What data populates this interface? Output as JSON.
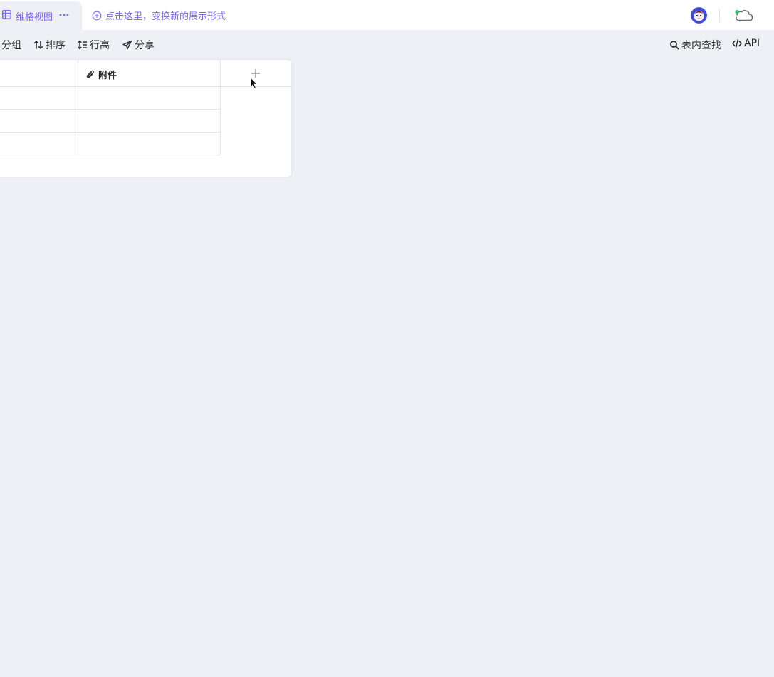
{
  "tabs": {
    "active_view": {
      "label": "维格视图",
      "icon": "grid-view-icon"
    },
    "add_view_label": "点击这里，变换新的展示形式"
  },
  "toolbar": {
    "group_label": "分组",
    "sort_label": "排序",
    "row_height_label": "行高",
    "share_label": "分享",
    "search_label": "表内查找",
    "api_label": "API"
  },
  "grid": {
    "columns": [
      {
        "name": "",
        "type": "text"
      },
      {
        "name": "附件",
        "type": "attachment",
        "icon": "attachment-icon"
      }
    ],
    "rows": [
      [
        "",
        ""
      ],
      [
        "",
        ""
      ],
      [
        "",
        ""
      ]
    ]
  },
  "colors": {
    "accent": "#7b67ee",
    "page_background": "#eff0f5",
    "border": "#e4e5ea",
    "text": "#262626"
  }
}
